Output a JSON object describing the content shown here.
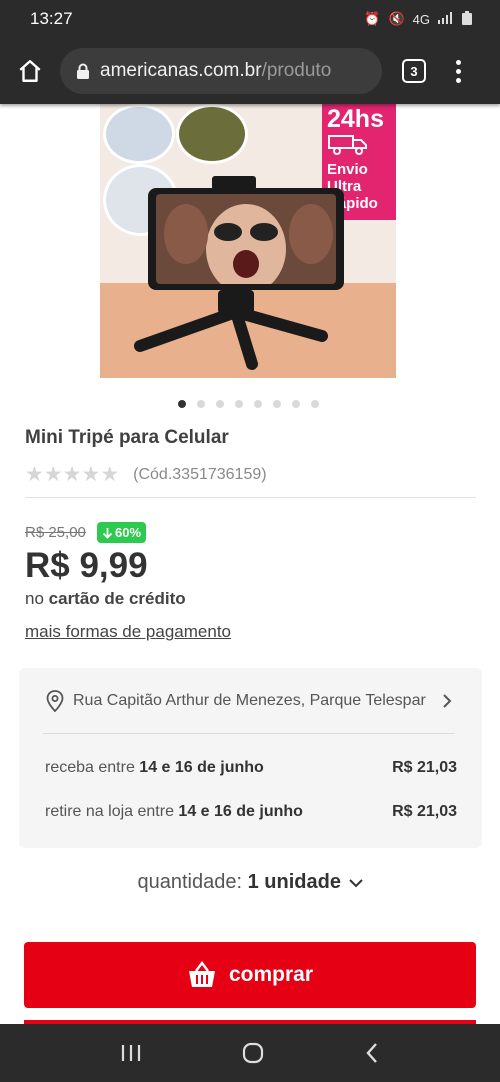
{
  "status_bar": {
    "time": "13:27",
    "network": "4G"
  },
  "browser": {
    "url_host": "americanas.com.br",
    "url_path": "/produto",
    "tab_count": "3"
  },
  "promo_badge": {
    "line1": "24hs",
    "line2": "Envio",
    "line3": "Ultra",
    "line4": "Rápido"
  },
  "carousel": {
    "total_dots": 8,
    "active_index": 0
  },
  "product": {
    "title": "Mini Tripé para Celular",
    "rating": 0,
    "code": "(Cód.3351736159)"
  },
  "pricing": {
    "old_price": "R$ 25,00",
    "discount": "60%",
    "price": "R$ 9,99",
    "payment_prefix": "no",
    "payment_method": "cartão de crédito",
    "more_payments": "mais formas de pagamento"
  },
  "shipping": {
    "address": "Rua Capitão Arthur de Menezes, Parque Telespar",
    "options": [
      {
        "prefix": "receba entre",
        "dates": "14 e 16 de junho",
        "price": "R$ 21,03"
      },
      {
        "prefix": "retire na loja entre",
        "dates": "14 e 16 de junho",
        "price": "R$ 21,03"
      }
    ]
  },
  "quantity": {
    "label": "quantidade:",
    "value": "1 unidade"
  },
  "buy_button": {
    "label": "comprar"
  },
  "colors": {
    "accent": "#e60014",
    "discount": "#2ec94f",
    "promo": "#e32570"
  }
}
